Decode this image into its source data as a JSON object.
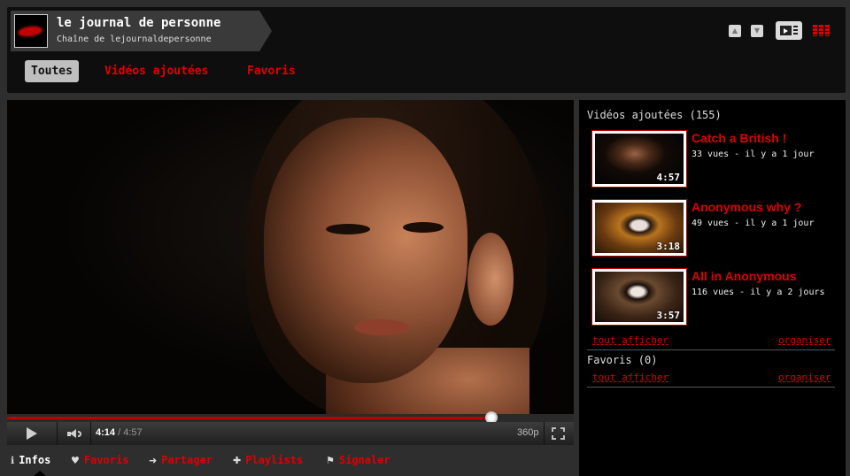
{
  "channel": {
    "name": "le journal de personne",
    "subtitle": "Chaîne de lejournaldepersonne"
  },
  "header": {
    "icons": [
      "chevron-up-icon",
      "chevron-down-icon",
      "player-view-icon",
      "grid-view-icon"
    ]
  },
  "tabs": [
    {
      "label": "Toutes",
      "active": true
    },
    {
      "label": "Vidéos ajoutées",
      "active": false
    },
    {
      "label": "Favoris",
      "active": false
    }
  ],
  "player": {
    "current_time": "4:14",
    "separator": " / ",
    "duration": "4:57",
    "quality": "360p",
    "progress_fraction": 0.855,
    "buffered_fraction": 0.855
  },
  "actions": [
    {
      "label": "Infos",
      "icon": "info-icon",
      "active": true
    },
    {
      "label": "Favoris",
      "icon": "heart-icon",
      "active": false
    },
    {
      "label": "Partager",
      "icon": "share-arrow-icon",
      "active": false
    },
    {
      "label": "Playlists",
      "icon": "plus-icon",
      "active": false
    },
    {
      "label": "Signaler",
      "icon": "flag-icon",
      "active": false
    }
  ],
  "sidebar": {
    "uploads_title": "Vidéos ajoutées (155)",
    "videos": [
      {
        "title": "Catch a British !",
        "meta": "33 vues - il y a 1 jour",
        "duration": "4:57"
      },
      {
        "title": "Anonymous why ?",
        "meta": "49 vues - il y a 1 jour",
        "duration": "3:18"
      },
      {
        "title": "All in Anonymous",
        "meta": "116 vues - il y a 2 jours",
        "duration": "3:57"
      }
    ],
    "show_all": "tout afficher",
    "organize": "organiser",
    "favorites_title": "Favoris (0)",
    "fav_show_all": "tout afficher",
    "fav_organize": "organiser"
  },
  "colors": {
    "accent": "#e00000",
    "background": "#2e2e2e",
    "panel": "#000000"
  }
}
